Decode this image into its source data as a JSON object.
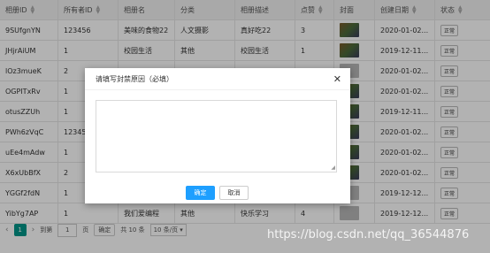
{
  "table": {
    "headers": [
      "相册ID",
      "所有者ID",
      "相册名",
      "分类",
      "相册描述",
      "点赞",
      "封面",
      "创建日期",
      "状态"
    ],
    "rows": [
      {
        "id": "9SUfgnYN",
        "owner": "123456",
        "name": "美味的食物22",
        "cat": "人文摄影",
        "desc": "真好吃22",
        "likes": "3",
        "date": "2020-01-02...",
        "status": "正常"
      },
      {
        "id": "JHjrAiUM",
        "owner": "1",
        "name": "校园生活",
        "cat": "其他",
        "desc": "校园生活",
        "likes": "1",
        "date": "2019-12-11...",
        "status": "正常"
      },
      {
        "id": "lOz3mueK",
        "owner": "2",
        "name": "",
        "cat": "",
        "desc": "",
        "likes": "",
        "date": "2020-01-02...",
        "status": "正常"
      },
      {
        "id": "OGPITxRv",
        "owner": "1",
        "name": "",
        "cat": "",
        "desc": "",
        "likes": "",
        "date": "2020-01-02...",
        "status": "正常"
      },
      {
        "id": "otusZZUh",
        "owner": "1",
        "name": "",
        "cat": "",
        "desc": "",
        "likes": "",
        "date": "2019-12-11...",
        "status": "正常"
      },
      {
        "id": "PWh6zVqC",
        "owner": "12345",
        "name": "",
        "cat": "",
        "desc": "",
        "likes": "",
        "date": "2020-01-02...",
        "status": "正常"
      },
      {
        "id": "uEe4mAdw",
        "owner": "1",
        "name": "",
        "cat": "",
        "desc": "",
        "likes": "",
        "date": "2020-01-02...",
        "status": "正常"
      },
      {
        "id": "X6xUbBfX",
        "owner": "2",
        "name": "",
        "cat": "",
        "desc": "",
        "likes": "",
        "date": "2020-01-02...",
        "status": "正常"
      },
      {
        "id": "YGGf2fdN",
        "owner": "1",
        "name": "",
        "cat": "",
        "desc": "",
        "likes": "",
        "date": "2019-12-12...",
        "status": "正常"
      },
      {
        "id": "YibYg7AP",
        "owner": "1",
        "name": "我们爱编程",
        "cat": "其他",
        "desc": "快乐学习",
        "likes": "4",
        "date": "2019-12-12...",
        "status": "正常"
      }
    ]
  },
  "pager": {
    "current": "1",
    "goto_label": "到第",
    "goto_value": "1",
    "page_unit": "页",
    "confirm": "确定",
    "total": "共 10 条",
    "per_page": "10 条/页"
  },
  "dialog": {
    "title": "请填写封禁原因（必填）",
    "close": "✕",
    "confirm": "确定",
    "cancel": "取消"
  },
  "watermark": "https://blog.csdn.net/qq_36544876"
}
